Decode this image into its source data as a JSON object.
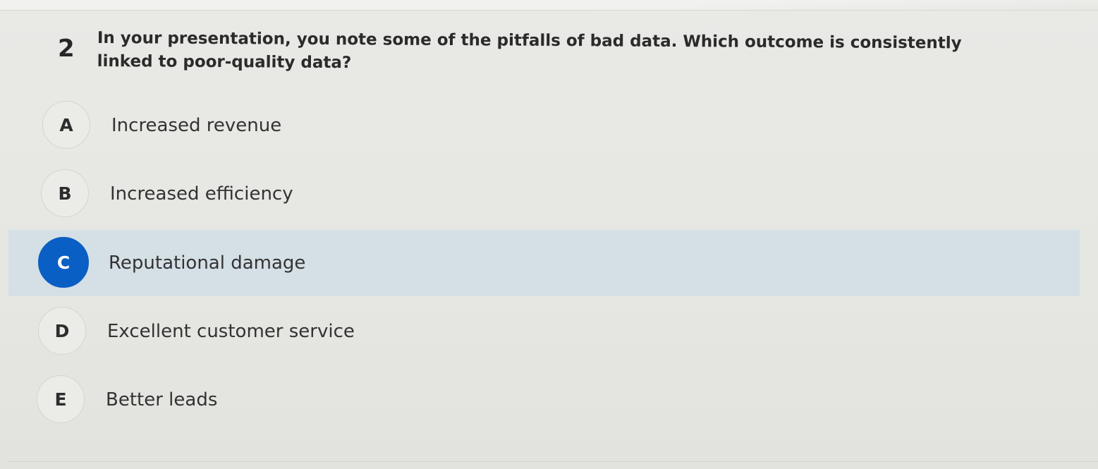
{
  "question": {
    "number": "2",
    "text": "In your presentation, you note some of the pitfalls of bad data. Which outcome is consistently linked to poor-quality data?"
  },
  "options": [
    {
      "letter": "A",
      "label": "Increased revenue",
      "selected": false
    },
    {
      "letter": "B",
      "label": "Increased efficiency",
      "selected": false
    },
    {
      "letter": "C",
      "label": "Reputational damage",
      "selected": true
    },
    {
      "letter": "D",
      "label": "Excellent customer service",
      "selected": false
    },
    {
      "letter": "E",
      "label": "Better leads",
      "selected": false
    }
  ],
  "colors": {
    "selected_badge": "#0a5fc4",
    "selected_row": "#d5dfe6",
    "background": "#e7e7e4"
  }
}
